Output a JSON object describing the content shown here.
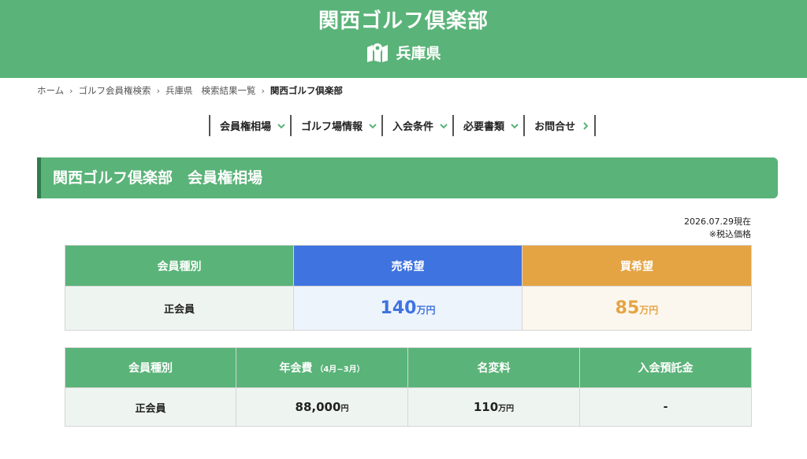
{
  "header": {
    "title": "関西ゴルフ倶楽部",
    "prefecture": "兵庫県",
    "map_icon": "map-pin-icon"
  },
  "breadcrumb": {
    "home": "ホーム",
    "search": "ゴルフ会員権検索",
    "prefecture": "兵庫県",
    "results": "検索結果一覧",
    "current": "関西ゴルフ倶楽部"
  },
  "subnav": {
    "items": [
      {
        "label": "会員権相場",
        "icon": "chevron-down-icon"
      },
      {
        "label": "ゴルフ場情報",
        "icon": "chevron-down-icon"
      },
      {
        "label": "入会条件",
        "icon": "chevron-down-icon"
      },
      {
        "label": "必要書類",
        "icon": "chevron-down-icon"
      },
      {
        "label": "お問合せ",
        "icon": "chevron-right-icon"
      }
    ]
  },
  "section": {
    "title": "関西ゴルフ倶楽部　会員権相場"
  },
  "as_of": {
    "date": "2026.07.29現在",
    "tax_note": "※税込価格"
  },
  "price_table": {
    "headers": {
      "type": "会員種別",
      "sell": "売希望",
      "buy": "買希望"
    },
    "row": {
      "type": "正会員",
      "sell_value": "140",
      "sell_unit": "万円",
      "buy_value": "85",
      "buy_unit": "万円"
    }
  },
  "fee_table": {
    "headers": {
      "type": "会員種別",
      "annual": "年会費",
      "annual_note": "（4月~3月）",
      "transfer": "名変料",
      "deposit": "入会預託金"
    },
    "row": {
      "type": "正会員",
      "annual_value": "88,000",
      "annual_unit": "円",
      "transfer_value": "110",
      "transfer_unit": "万円",
      "deposit_value": "-"
    }
  },
  "colors": {
    "brand_green": "#5ab378",
    "dark_green": "#2e7d4b",
    "sell_blue": "#3f73e0",
    "buy_orange": "#e5a444"
  }
}
